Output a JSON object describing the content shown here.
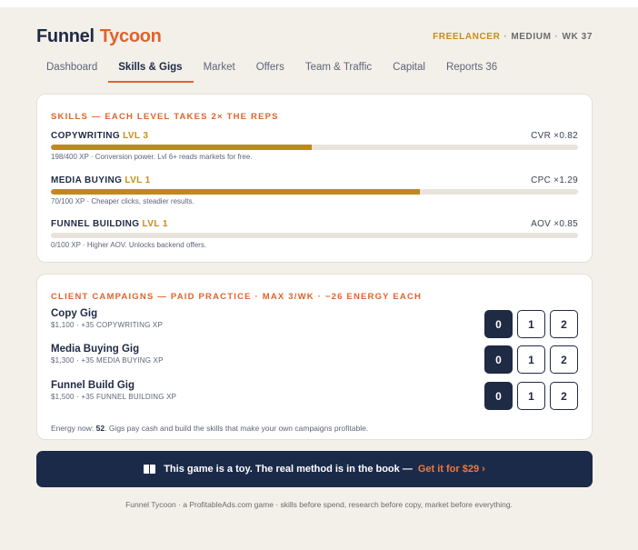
{
  "app": {
    "title_part1": "Funnel",
    "title_part2": "Tycoon"
  },
  "status": {
    "role": "FREELANCER",
    "difficulty": "MEDIUM",
    "week": "WK 37",
    "separator": "·"
  },
  "tabs": [
    {
      "label": "Dashboard",
      "active": false
    },
    {
      "label": "Skills & Gigs",
      "active": true
    },
    {
      "label": "Market",
      "active": false
    },
    {
      "label": "Offers",
      "active": false
    },
    {
      "label": "Team & Traffic",
      "active": false
    },
    {
      "label": "Capital",
      "active": false
    },
    {
      "label": "Reports 36",
      "active": false
    }
  ],
  "skills": {
    "title": "SKILLS — EACH LEVEL TAKES 2× THE REPS",
    "items": [
      {
        "name": "COPYWRITING",
        "level": "LVL 3",
        "stat": "CVR ×0.82",
        "xp": 198,
        "xp_max": 400,
        "desc": "198/400 XP · Conversion power. Lvl 6+ reads markets for free."
      },
      {
        "name": "MEDIA BUYING",
        "level": "LVL 1",
        "stat": "CPC ×1.29",
        "xp": 70,
        "xp_max": 100,
        "desc": "70/100 XP · Cheaper clicks, steadier results."
      },
      {
        "name": "FUNNEL BUILDING",
        "level": "LVL 1",
        "stat": "AOV ×0.85",
        "xp": 0,
        "xp_max": 100,
        "desc": "0/100 XP · Higher AOV. Unlocks backend offers."
      }
    ]
  },
  "gigs": {
    "title": "CLIENT CAMPAIGNS — PAID PRACTICE · MAX 3/WK · −26 ENERGY EACH",
    "items": [
      {
        "name": "Copy Gig",
        "sub": "$1,100 · +35 COPYWRITING XP",
        "options": [
          "0",
          "1",
          "2"
        ],
        "selected": 0
      },
      {
        "name": "Media Buying Gig",
        "sub": "$1,300 · +35 MEDIA BUYING XP",
        "options": [
          "0",
          "1",
          "2"
        ],
        "selected": 0
      },
      {
        "name": "Funnel Build Gig",
        "sub": "$1,500 · +35 FUNNEL BUILDING XP",
        "options": [
          "0",
          "1",
          "2"
        ],
        "selected": 0
      }
    ],
    "energy_label": "Energy now:",
    "energy_value": "52",
    "energy_note": ". Gigs pay cash and build the skills that make your own campaigns profitable."
  },
  "promo": {
    "icon": "book-icon",
    "text": "This game is a toy. The real method is in the book —",
    "cta": "Get it for $29 ›"
  },
  "footer": {
    "text": "Funnel Tycoon · a ProfitableAds.com game · skills before spend, research before copy, market before everything."
  },
  "colors": {
    "accent": "#e0632a",
    "gold": "#c08a19",
    "navy": "#1c2a4a",
    "background": "#f3f0ea"
  }
}
